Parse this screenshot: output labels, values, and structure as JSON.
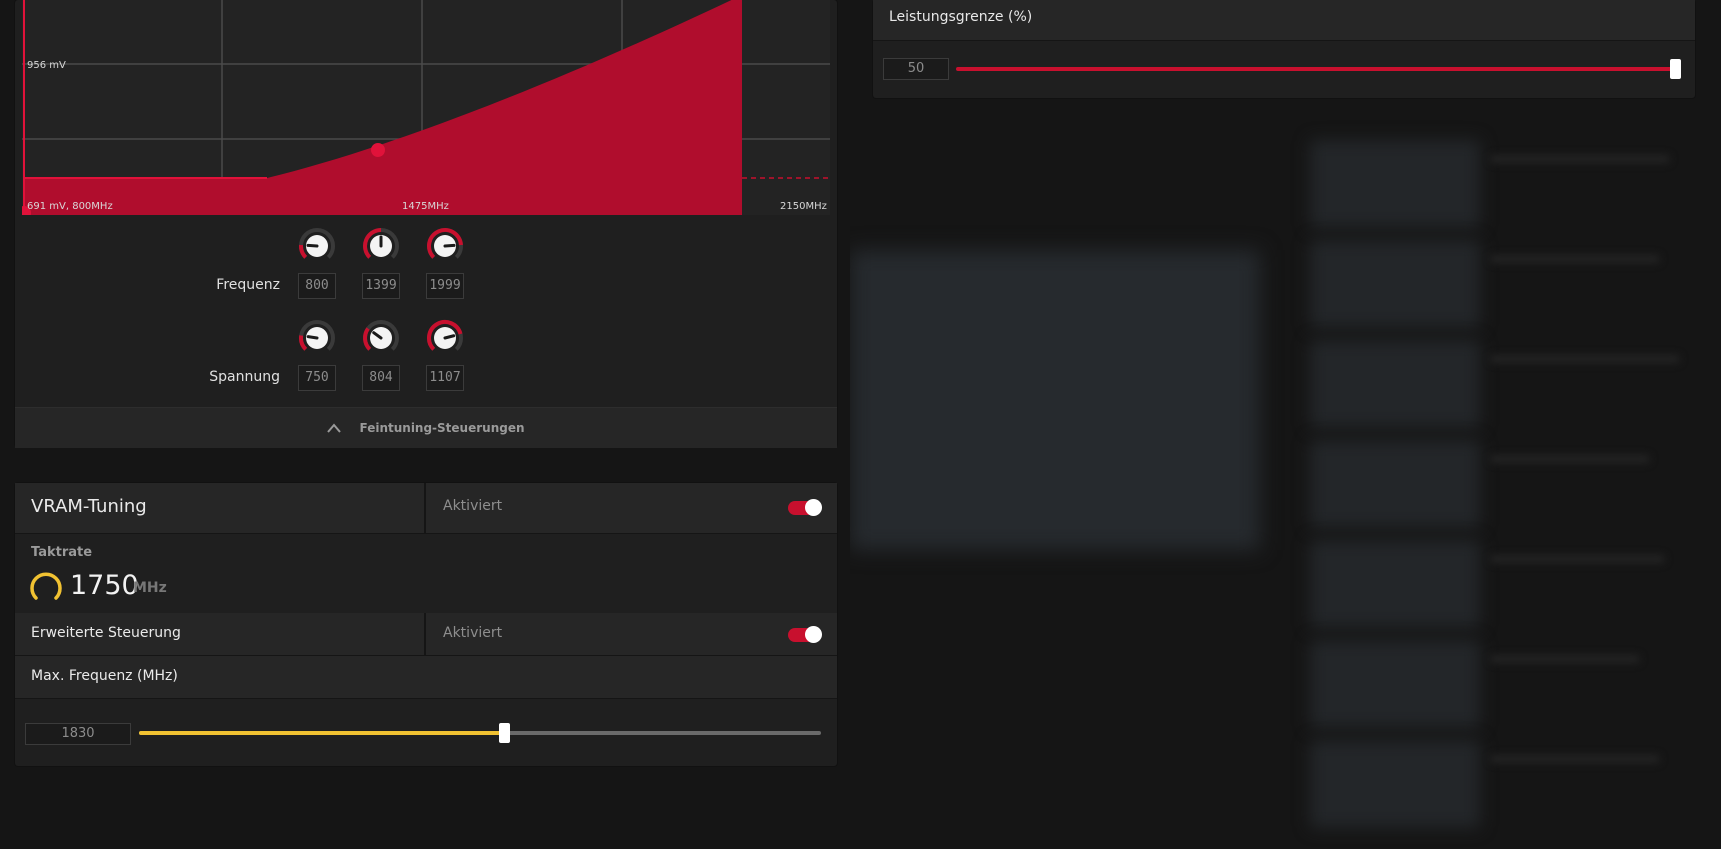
{
  "curve": {
    "labels": {
      "top_voltage": "956 mV",
      "bottom_left": "691 mV, 800MHz",
      "mid_freq": "1475MHz",
      "max_freq": "2150MHz"
    },
    "colors": {
      "fill": "#b00d2d",
      "point": "#e0123a",
      "grid": "#4a4a4a",
      "bg": "#232323"
    }
  },
  "tuning": {
    "frequency": {
      "label": "Frequenz",
      "values": [
        "800",
        "1399",
        "1999"
      ]
    },
    "voltage": {
      "label": "Spannung",
      "values": [
        "750",
        "804",
        "1107"
      ]
    },
    "fine_tune_label": "Feintuning-Steuerungen"
  },
  "power_limit": {
    "title": "Leistungsgrenze (%)",
    "value": "50",
    "slider_fraction": 1.0
  },
  "vram": {
    "title": "VRAM-Tuning",
    "status": "Aktiviert",
    "clock": {
      "label": "Taktrate",
      "value": "1750",
      "unit": "MHz"
    },
    "advanced": {
      "title": "Erweiterte Steuerung",
      "status": "Aktiviert"
    },
    "max_freq": {
      "title": "Max. Frequenz (MHz)",
      "value": "1830",
      "slider_fraction": 0.535
    }
  },
  "accent_red": "#c8102e",
  "accent_yellow": "#f1c232"
}
